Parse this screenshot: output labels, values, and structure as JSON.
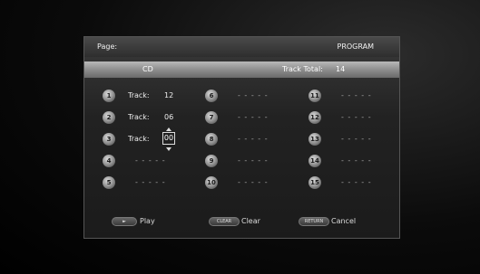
{
  "page": {
    "label": "Page:",
    "value": "PROGRAM"
  },
  "header": {
    "source": "CD",
    "track_total_label": "Track Total:",
    "track_total_value": "14"
  },
  "slots": [
    {
      "number": "1",
      "label": "Track:",
      "value": "12"
    },
    {
      "number": "2",
      "label": "Track:",
      "value": "06"
    },
    {
      "number": "3",
      "label": "Track:",
      "value": "00"
    },
    {
      "number": "4",
      "placeholder": "- - - - -"
    },
    {
      "number": "5",
      "placeholder": "- - - - -"
    },
    {
      "number": "6",
      "placeholder": "- - - - -"
    },
    {
      "number": "7",
      "placeholder": "- - - - -"
    },
    {
      "number": "8",
      "placeholder": "- - - - -"
    },
    {
      "number": "9",
      "placeholder": "- - - - -"
    },
    {
      "number": "10",
      "placeholder": "- - - - -"
    },
    {
      "number": "11",
      "placeholder": "- - - - -"
    },
    {
      "number": "12",
      "placeholder": "- - - - -"
    },
    {
      "number": "13",
      "placeholder": "- - - - -"
    },
    {
      "number": "14",
      "placeholder": "- - - - -"
    },
    {
      "number": "15",
      "placeholder": "- - - - -"
    }
  ],
  "footer": {
    "play_key": "►",
    "play_label": "Play",
    "clear_key": "CLEAR",
    "clear_label": "Clear",
    "return_key": "RETURN",
    "return_label": "Cancel"
  }
}
